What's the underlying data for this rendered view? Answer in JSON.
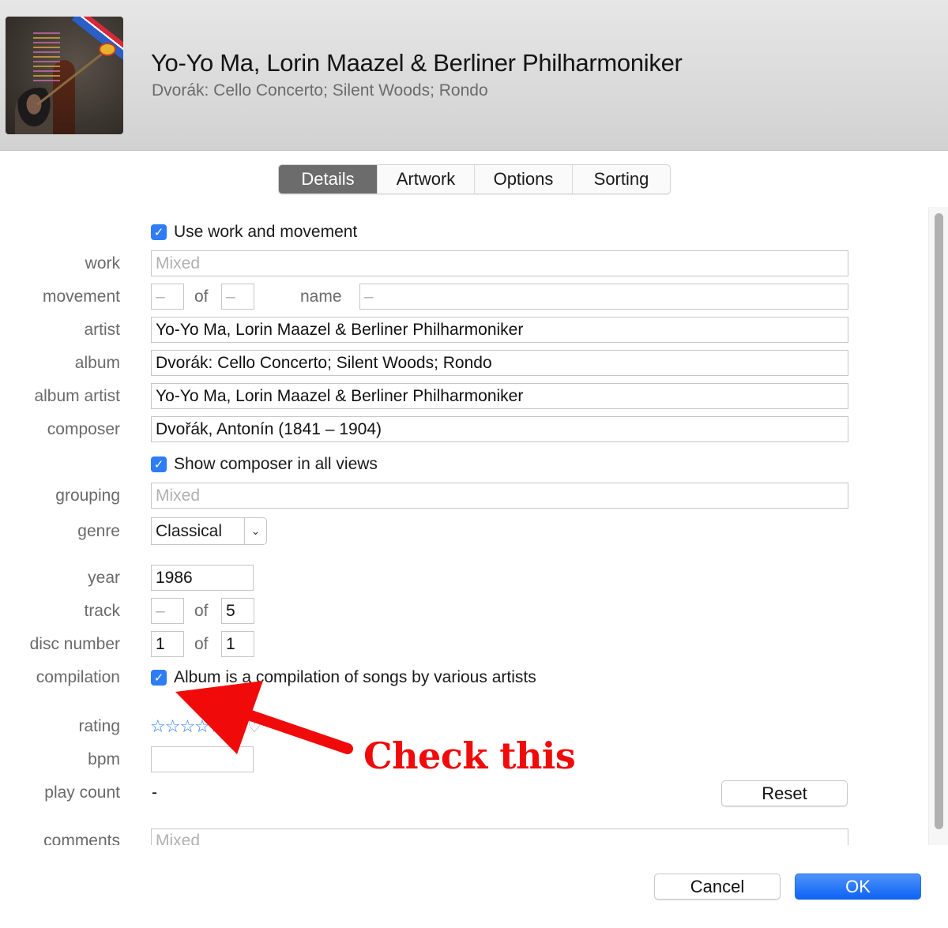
{
  "header": {
    "title": "Yo-Yo Ma, Lorin Maazel & Berliner Philharmoniker",
    "subtitle": "Dvorák: Cello Concerto; Silent Woods; Rondo"
  },
  "tabs": [
    {
      "label": "Details",
      "active": true
    },
    {
      "label": "Artwork",
      "active": false
    },
    {
      "label": "Options",
      "active": false
    },
    {
      "label": "Sorting",
      "active": false
    }
  ],
  "details": {
    "use_work_movement": {
      "label": "Use work and movement",
      "checked": true
    },
    "work": {
      "label": "work",
      "placeholder": "Mixed",
      "value": ""
    },
    "movement": {
      "label": "movement",
      "number": "–",
      "of_label": "of",
      "count": "–",
      "name_label": "name",
      "name": "–"
    },
    "artist": {
      "label": "artist",
      "value": "Yo-Yo Ma, Lorin Maazel & Berliner Philharmoniker"
    },
    "album": {
      "label": "album",
      "value": "Dvorák: Cello Concerto; Silent Woods; Rondo"
    },
    "album_artist": {
      "label": "album artist",
      "value": "Yo-Yo Ma, Lorin Maazel & Berliner Philharmoniker"
    },
    "composer": {
      "label": "composer",
      "value": "Dvořák, Antonín (1841 – 1904)"
    },
    "show_composer": {
      "label": "Show composer in all views",
      "checked": true
    },
    "grouping": {
      "label": "grouping",
      "placeholder": "Mixed",
      "value": ""
    },
    "genre": {
      "label": "genre",
      "value": "Classical"
    },
    "year": {
      "label": "year",
      "value": "1986"
    },
    "track": {
      "label": "track",
      "number": "–",
      "of_label": "of",
      "count": "5"
    },
    "disc": {
      "label": "disc number",
      "number": "1",
      "of_label": "of",
      "count": "1"
    },
    "compilation": {
      "label": "compilation",
      "checkbox_label": "Album is a compilation of songs by various artists",
      "checked": true
    },
    "rating": {
      "label": "rating",
      "stars": "☆☆☆☆☆",
      "value": 0,
      "max": 5,
      "loved": false,
      "heart": "♡"
    },
    "bpm": {
      "label": "bpm",
      "value": ""
    },
    "play_count": {
      "label": "play count",
      "value": "-",
      "reset_label": "Reset"
    },
    "comments": {
      "label": "comments",
      "placeholder": "Mixed",
      "value": ""
    }
  },
  "footer": {
    "cancel_label": "Cancel",
    "ok_label": "OK"
  },
  "annotation": {
    "text": "Check this",
    "color": "#f00a0a"
  },
  "colors": {
    "accent": "#2e7cf6",
    "tab_active": "#6c6c6c",
    "ok_button": "#0f64f5"
  }
}
